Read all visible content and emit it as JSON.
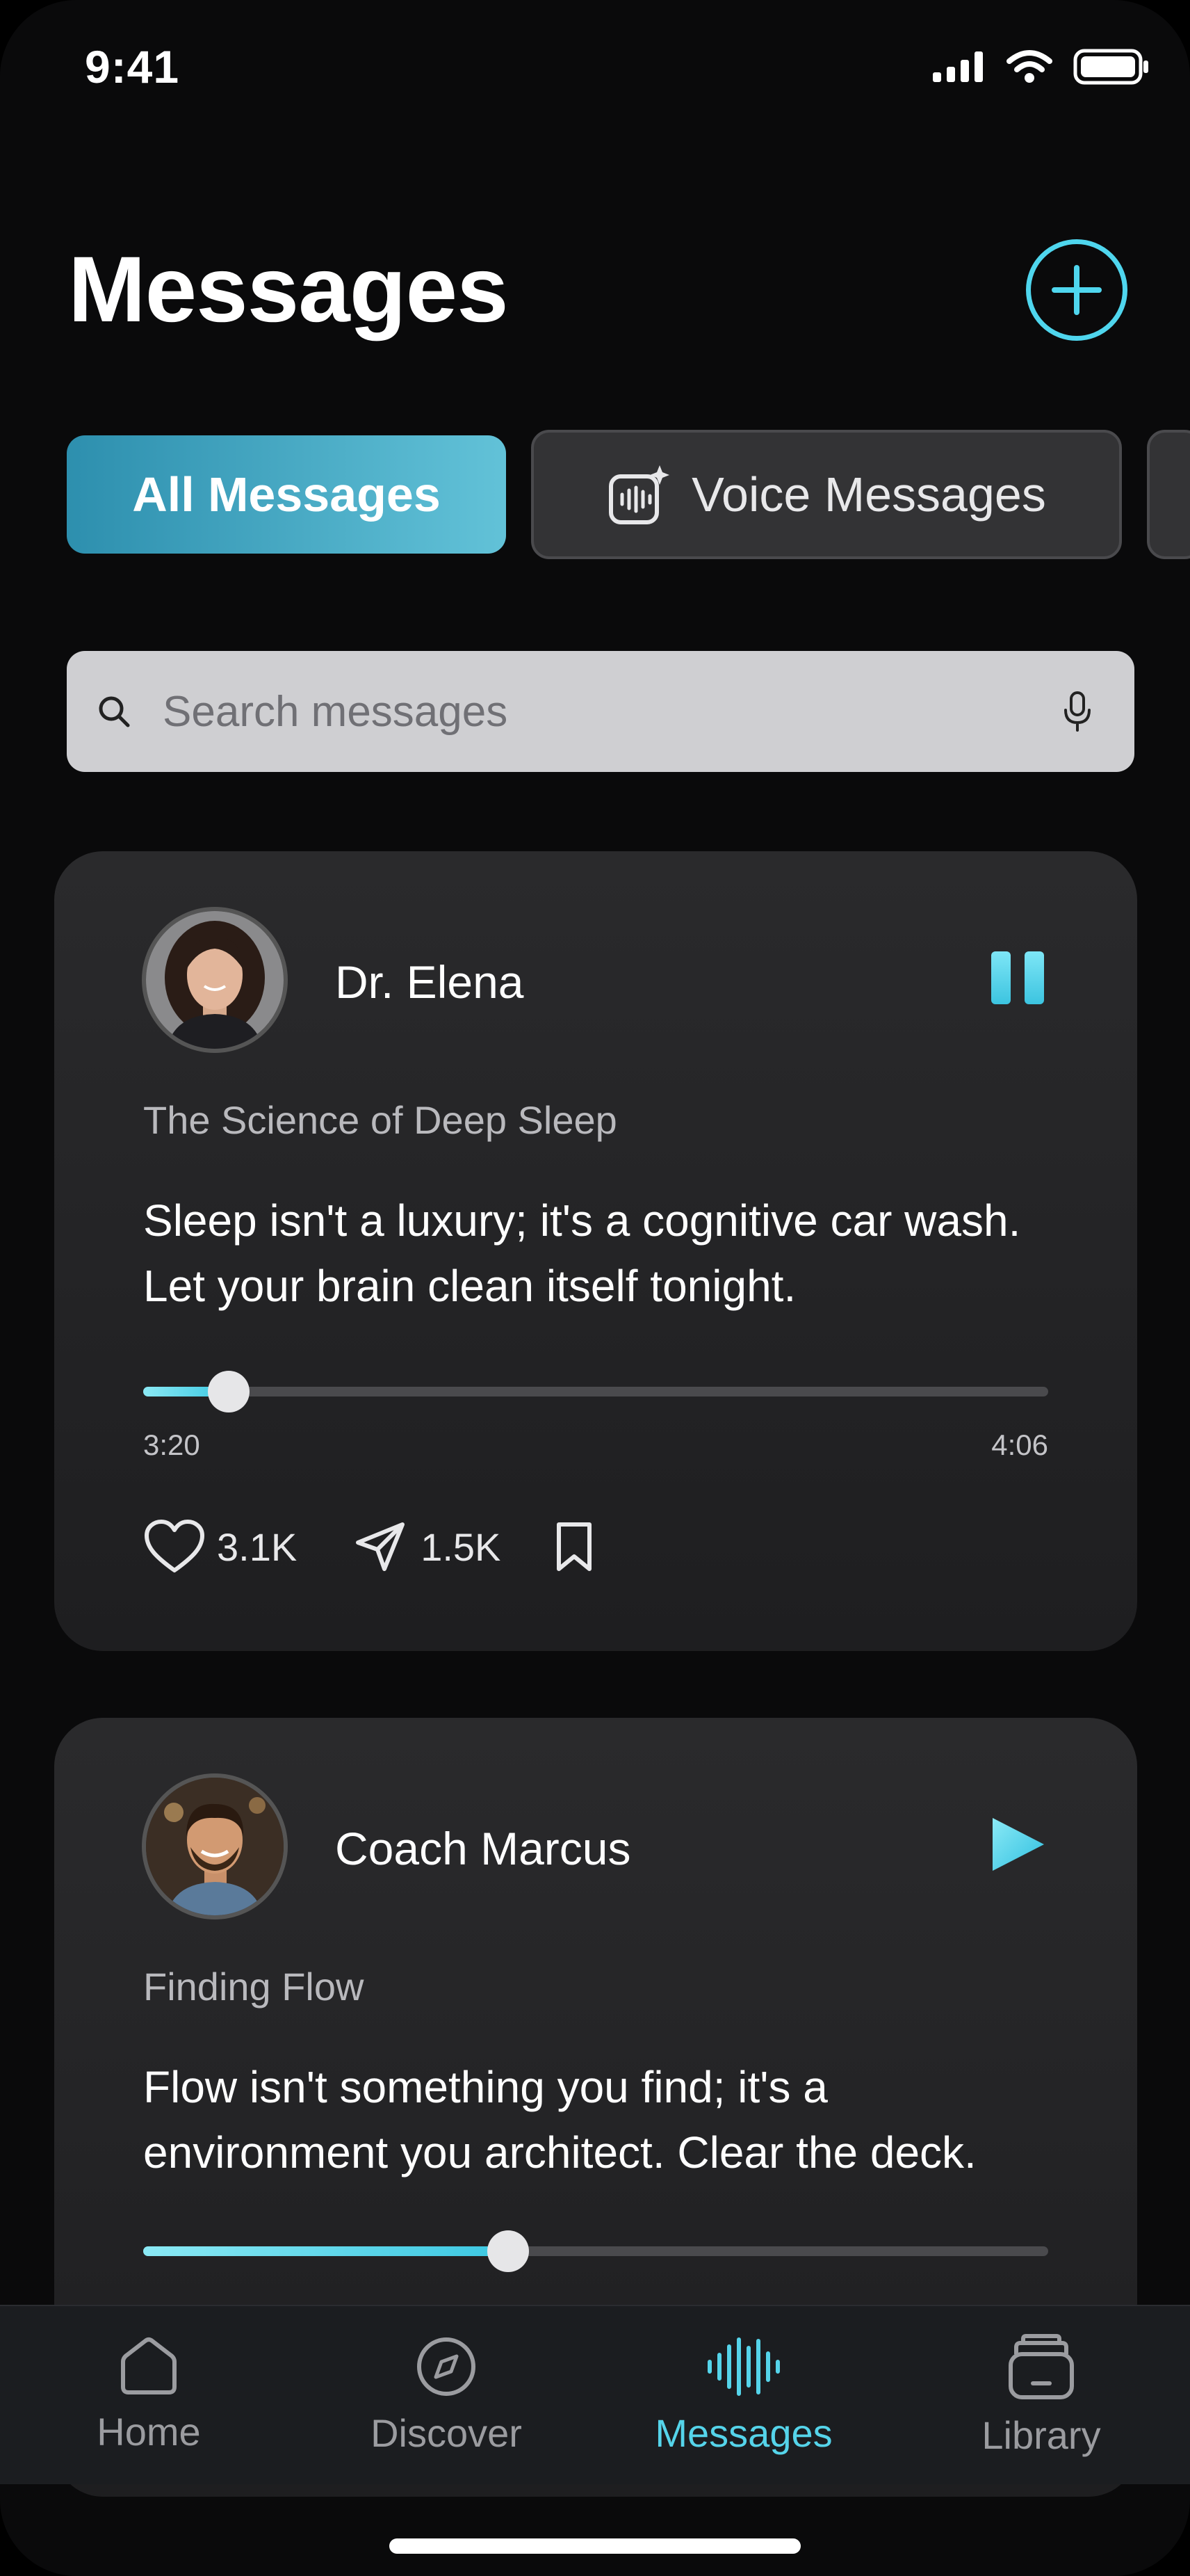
{
  "status": {
    "time": "9:41"
  },
  "header": {
    "title": "Messages"
  },
  "tabs": [
    {
      "label": "All Messages",
      "active": true
    },
    {
      "label": "Voice Messages",
      "active": false
    }
  ],
  "search": {
    "placeholder": "Search messages"
  },
  "cards": [
    {
      "author": "Dr. Elena",
      "episode": "The Science of Deep Sleep",
      "quote": "Sleep isn't a luxury; it's a cognitive car wash. Let your brain clean itself tonight.",
      "elapsed": "3:20",
      "duration": "4:06",
      "progress": 0.09,
      "likes": "3.1K",
      "shares": "1.5K",
      "state": "playing"
    },
    {
      "author": "Coach Marcus",
      "episode": "Finding Flow",
      "quote": "Flow isn't something you find; it's a environment you architect. Clear the deck.",
      "progress": 0.4,
      "state": "paused"
    }
  ],
  "nav": [
    {
      "label": "Home",
      "icon": "home-icon"
    },
    {
      "label": "Discover",
      "icon": "compass-icon"
    },
    {
      "label": "Messages",
      "icon": "waveform-icon",
      "active": true
    },
    {
      "label": "Library",
      "icon": "library-icon"
    }
  ],
  "colors": {
    "accent": "#55d4ea",
    "background": "#0a0a0b",
    "card": "#262628"
  }
}
